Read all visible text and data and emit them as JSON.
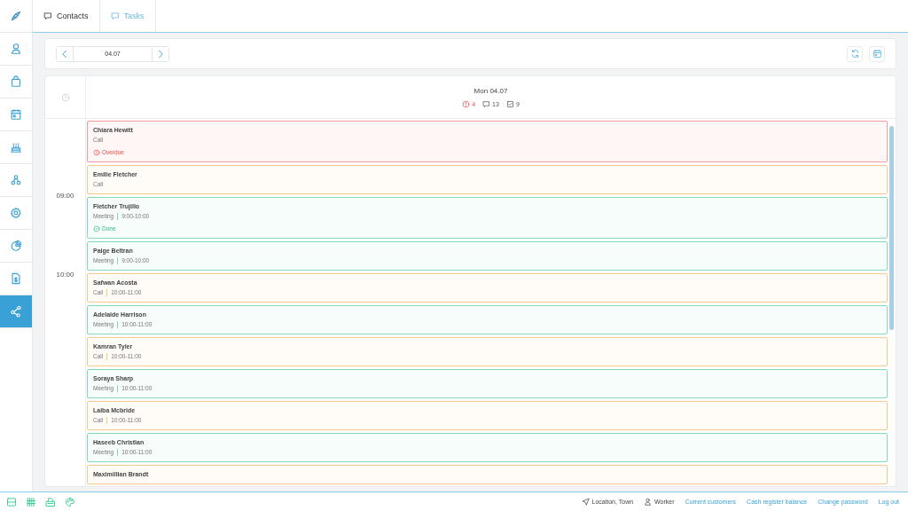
{
  "tabs": [
    {
      "label": "Contacts",
      "selected": true
    },
    {
      "label": "Tasks",
      "selected": false
    }
  ],
  "sidebar": {
    "items": [
      {
        "selected": false
      },
      {
        "selected": false
      },
      {
        "selected": false
      },
      {
        "selected": false
      },
      {
        "selected": false
      },
      {
        "selected": false
      },
      {
        "selected": false
      },
      {
        "selected": false
      },
      {
        "selected": true
      }
    ]
  },
  "date_nav": {
    "value": "04.07"
  },
  "day": {
    "title": "Mon 04.07",
    "overdue_count": "4",
    "comment_count": "13",
    "task_count": "9"
  },
  "time_labels": [
    "09:00",
    "10:00"
  ],
  "tasks": [
    {
      "name": "Chiara Hewitt",
      "type": "Call",
      "kind": "call",
      "overdue": true,
      "status_label": "Overdue"
    },
    {
      "name": "Emilie Fletcher",
      "type": "Call",
      "kind": "call"
    },
    {
      "name": "Fletcher Trujillo",
      "type": "Meeting",
      "kind": "meeting",
      "time": "9:00-10:00",
      "done": true,
      "status_label": "Done"
    },
    {
      "name": "Paige Beltran",
      "type": "Meeting",
      "kind": "meeting",
      "time": "9:00-10:00"
    },
    {
      "name": "Safwan Acosta",
      "type": "Call",
      "kind": "call",
      "time": "10:00-11:00"
    },
    {
      "name": "Adelaide Harrison",
      "type": "Meeting",
      "kind": "meeting",
      "time": "10:00-11:00"
    },
    {
      "name": "Kamran Tyler",
      "type": "Call",
      "kind": "call",
      "time": "10:00-11:00"
    },
    {
      "name": "Soraya Sharp",
      "type": "Meeting",
      "kind": "meeting",
      "time": "10:00-11:00"
    },
    {
      "name": "Laiba Mcbride",
      "type": "Call",
      "kind": "call",
      "time": "10:00-11:00"
    },
    {
      "name": "Haseeb Christian",
      "type": "Meeting",
      "kind": "meeting",
      "time": "10:00-11:00"
    },
    {
      "name": "Maximillian Brandt",
      "kind": "call"
    }
  ],
  "footer": {
    "location": "Location, Town",
    "user": "Worker",
    "links": [
      "Current customers",
      "Cash register balance",
      "Change password",
      "Log out"
    ]
  }
}
